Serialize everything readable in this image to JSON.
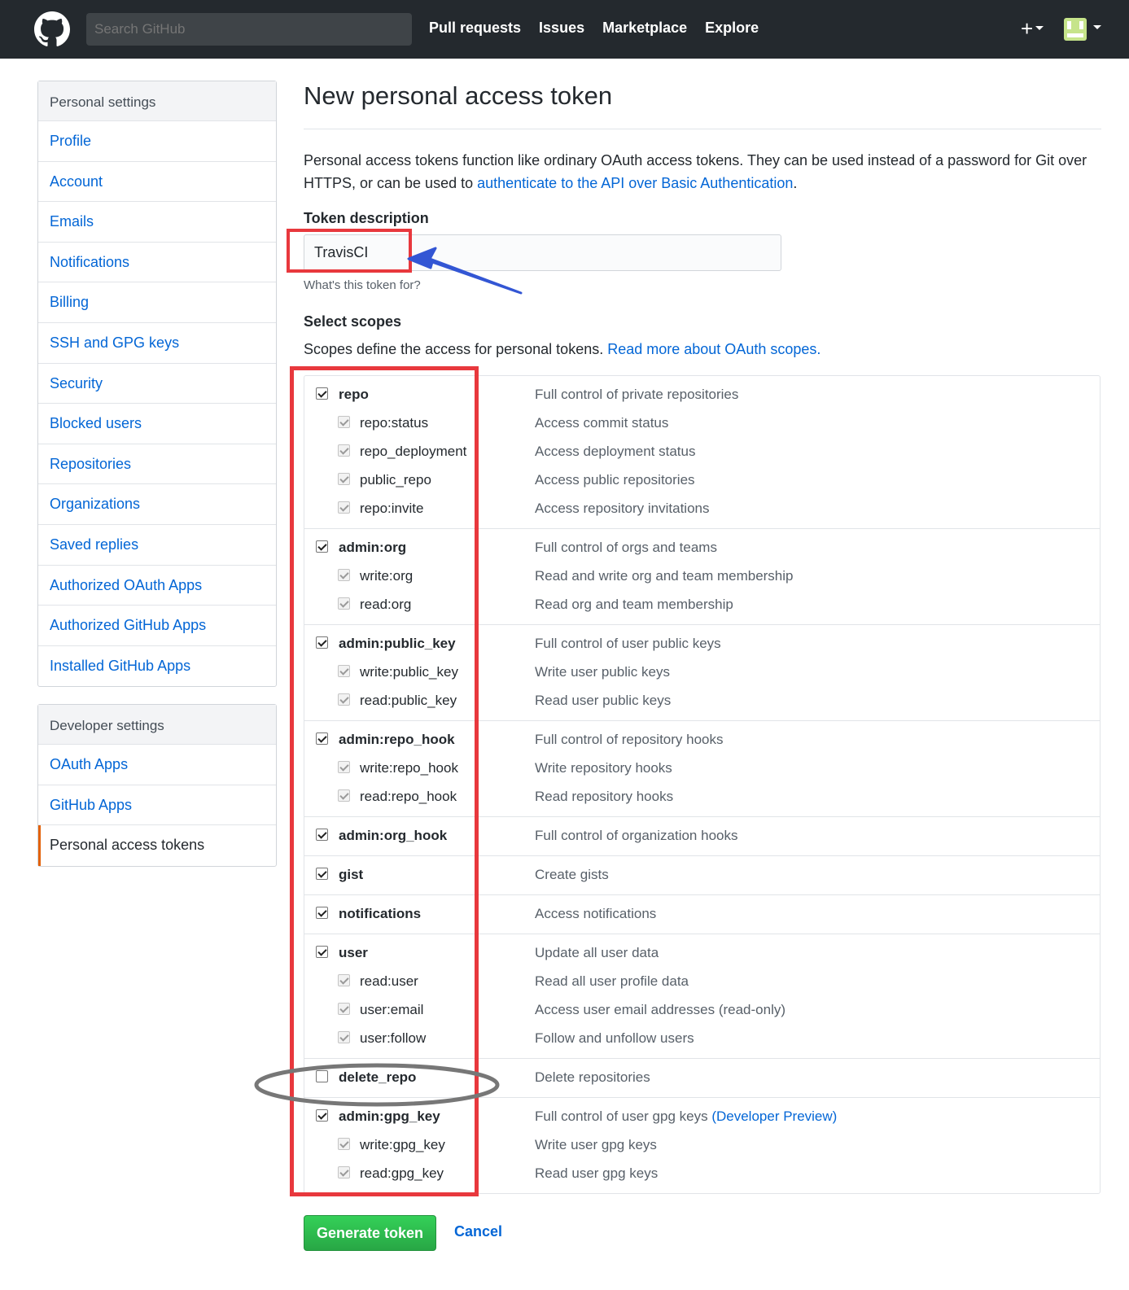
{
  "header": {
    "search_placeholder": "Search GitHub",
    "nav": [
      "Pull requests",
      "Issues",
      "Marketplace",
      "Explore"
    ],
    "plus_label": "+"
  },
  "sidebar": {
    "personal": {
      "heading": "Personal settings",
      "items": [
        "Profile",
        "Account",
        "Emails",
        "Notifications",
        "Billing",
        "SSH and GPG keys",
        "Security",
        "Blocked users",
        "Repositories",
        "Organizations",
        "Saved replies",
        "Authorized OAuth Apps",
        "Authorized GitHub Apps",
        "Installed GitHub Apps"
      ]
    },
    "developer": {
      "heading": "Developer settings",
      "items": [
        "OAuth Apps",
        "GitHub Apps",
        "Personal access tokens"
      ],
      "selected": "Personal access tokens"
    }
  },
  "main": {
    "title": "New personal access token",
    "intro_text": "Personal access tokens function like ordinary OAuth access tokens. They can be used instead of a password for Git over HTTPS, or can be used to ",
    "intro_link": "authenticate to the API over Basic Authentication",
    "intro_end": ".",
    "token_label": "Token description",
    "token_value": "TravisCI",
    "token_hint": "What's this token for?",
    "scopes_label": "Select scopes",
    "scopes_note": "Scopes define the access for personal tokens. ",
    "scopes_link": "Read more about OAuth scopes.",
    "generate_label": "Generate token",
    "cancel_label": "Cancel"
  },
  "scopes": [
    {
      "name": "repo",
      "desc": "Full control of private repositories",
      "checked": true,
      "children": [
        {
          "name": "repo:status",
          "desc": "Access commit status",
          "checked": true
        },
        {
          "name": "repo_deployment",
          "desc": "Access deployment status",
          "checked": true
        },
        {
          "name": "public_repo",
          "desc": "Access public repositories",
          "checked": true
        },
        {
          "name": "repo:invite",
          "desc": "Access repository invitations",
          "checked": true
        }
      ]
    },
    {
      "name": "admin:org",
      "desc": "Full control of orgs and teams",
      "checked": true,
      "children": [
        {
          "name": "write:org",
          "desc": "Read and write org and team membership",
          "checked": true
        },
        {
          "name": "read:org",
          "desc": "Read org and team membership",
          "checked": true
        }
      ]
    },
    {
      "name": "admin:public_key",
      "desc": "Full control of user public keys",
      "checked": true,
      "children": [
        {
          "name": "write:public_key",
          "desc": "Write user public keys",
          "checked": true
        },
        {
          "name": "read:public_key",
          "desc": "Read user public keys",
          "checked": true
        }
      ]
    },
    {
      "name": "admin:repo_hook",
      "desc": "Full control of repository hooks",
      "checked": true,
      "children": [
        {
          "name": "write:repo_hook",
          "desc": "Write repository hooks",
          "checked": true
        },
        {
          "name": "read:repo_hook",
          "desc": "Read repository hooks",
          "checked": true
        }
      ]
    },
    {
      "name": "admin:org_hook",
      "desc": "Full control of organization hooks",
      "checked": true,
      "children": []
    },
    {
      "name": "gist",
      "desc": "Create gists",
      "checked": true,
      "children": []
    },
    {
      "name": "notifications",
      "desc": "Access notifications",
      "checked": true,
      "children": []
    },
    {
      "name": "user",
      "desc": "Update all user data",
      "checked": true,
      "children": [
        {
          "name": "read:user",
          "desc": "Read all user profile data",
          "checked": true
        },
        {
          "name": "user:email",
          "desc": "Access user email addresses (read-only)",
          "checked": true
        },
        {
          "name": "user:follow",
          "desc": "Follow and unfollow users",
          "checked": true
        }
      ]
    },
    {
      "name": "delete_repo",
      "desc": "Delete repositories",
      "checked": false,
      "children": []
    },
    {
      "name": "admin:gpg_key",
      "desc": "Full control of user gpg keys ",
      "desc_link": "(Developer Preview)",
      "checked": true,
      "children": [
        {
          "name": "write:gpg_key",
          "desc": "Write user gpg keys",
          "checked": true
        },
        {
          "name": "read:gpg_key",
          "desc": "Read user gpg keys",
          "checked": true
        }
      ]
    }
  ],
  "colors": {
    "header_bg": "#24292e",
    "link": "#0366d6",
    "annotation_red": "#e8383d",
    "annotation_arrow": "#3356d4",
    "annotation_ellipse": "#777777",
    "generate_green": "#28a745"
  },
  "icons": {
    "logo": "github-octocat-icon",
    "plus": "plus-icon",
    "caret": "caret-down-icon",
    "avatar": "identicon-avatar"
  }
}
